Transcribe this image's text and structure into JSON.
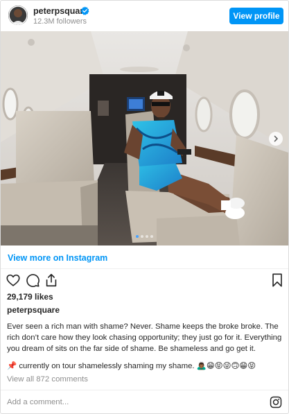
{
  "header": {
    "username": "peterpsquare",
    "followers": "12.3M followers",
    "view_profile_label": "View profile"
  },
  "post": {
    "view_more_label": "View more on Instagram",
    "likes": "29,179 likes",
    "caption_username": "peterpsquare",
    "caption_text": "Ever seen a rich man with shame? Never. Shame keeps the broke broke. The rich don’t care how they look chasing opportunity; they just go for it. Everything you dream of sits on the far side of shame. Be shameless and go get it.",
    "caption_line2": "📌 currently on tour shamelessly shaming my shame. 🙇🏾‍♂️😁😝😜🙃😁😝",
    "view_comments": "View all 872 comments",
    "carousel": {
      "slides": 4,
      "active_index": 0
    }
  },
  "comment_box": {
    "placeholder": "Add a comment..."
  },
  "colors": {
    "accent": "#0095f6",
    "text": "#262626",
    "muted": "#8e8e8e",
    "border": "#dbdbdb"
  },
  "icons": [
    "verified-badge-icon",
    "heart-icon",
    "comment-icon",
    "share-icon",
    "bookmark-icon",
    "instagram-icon",
    "chevron-right-icon"
  ]
}
